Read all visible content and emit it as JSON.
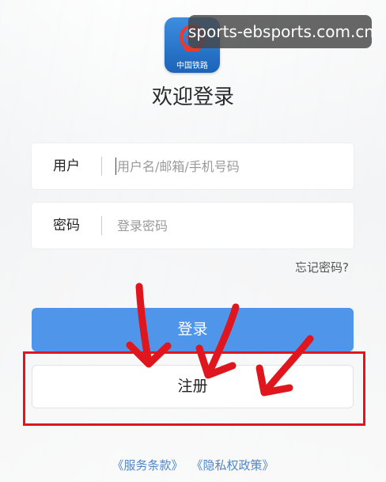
{
  "watermark": {
    "text": "sports-ebsports.com.cn"
  },
  "logo": {
    "icon": "china-railway-logo-icon",
    "caption": "中国铁路",
    "color_top": "#3d8ee0",
    "color_bottom": "#1b63b8"
  },
  "login": {
    "welcome_title": "欢迎登录",
    "user_field": {
      "label": "用户",
      "value": "",
      "placeholder": "用户名/邮箱/手机号码"
    },
    "password_field": {
      "label": "密码",
      "value": "",
      "placeholder": "登录密码"
    },
    "forgot_password": "忘记密码?",
    "login_button": "登录",
    "register_button": "注册"
  },
  "annotation": {
    "highlight_color": "#e0161e",
    "arrow_count": 3
  },
  "footer": {
    "terms_link": "《服务条款》",
    "privacy_link": "《隐私权政策》"
  },
  "colors": {
    "primary_button": "#4f95ea",
    "link": "#4f86c8"
  }
}
